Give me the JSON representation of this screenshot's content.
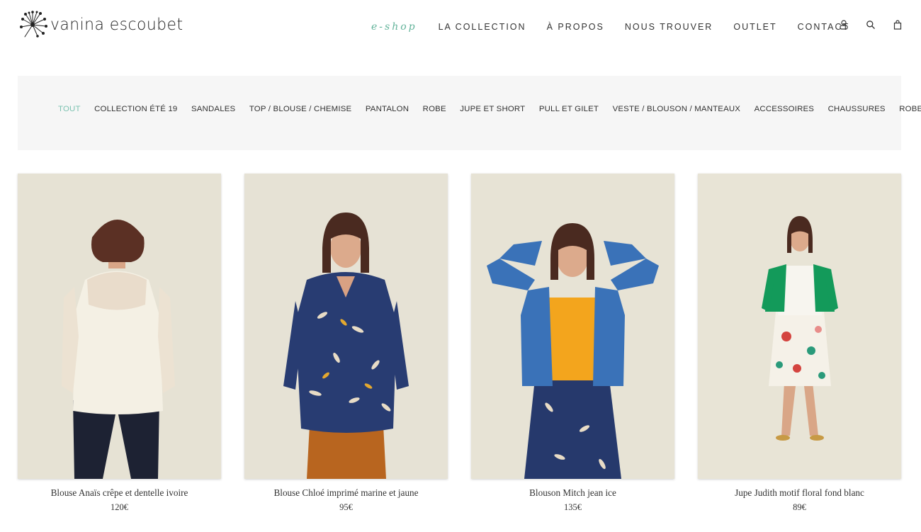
{
  "brand": {
    "name": "vanina escoubet"
  },
  "nav": {
    "items": [
      {
        "label": "e-shop"
      },
      {
        "label": "LA COLLECTION"
      },
      {
        "label": "À PROPOS"
      },
      {
        "label": "NOUS TROUVER"
      },
      {
        "label": "OUTLET"
      },
      {
        "label": "CONTACT"
      }
    ],
    "icons": [
      "user-icon",
      "search-icon",
      "shopping-bag-icon"
    ]
  },
  "filters": [
    {
      "label": "TOUT",
      "active": true
    },
    {
      "label": "COLLECTION ÉTÉ 19"
    },
    {
      "label": "SANDALES"
    },
    {
      "label": "TOP / BLOUSE / CHEMISE"
    },
    {
      "label": "PANTALON"
    },
    {
      "label": "ROBE"
    },
    {
      "label": "JUPE ET SHORT"
    },
    {
      "label": "PULL ET GILET"
    },
    {
      "label": "VESTE / BLOUSON / MANTEAUX"
    },
    {
      "label": "ACCESSOIRES"
    },
    {
      "label": "CHAUSSURES"
    },
    {
      "label": "ROBES"
    }
  ],
  "products": [
    {
      "name": "Blouse Anaïs crêpe et dentelle ivoire",
      "price": "120€"
    },
    {
      "name": "Blouse Chloé imprimé marine et jaune",
      "price": "95€"
    },
    {
      "name": "Blouson Mitch jean ice",
      "price": "135€"
    },
    {
      "name": "Jupe Judith motif floral fond blanc",
      "price": "89€"
    }
  ],
  "colors": {
    "accent": "#62b39a",
    "filter_active": "#7bc2b0",
    "filter_bg": "#f6f6f6",
    "photo_bg": "#e7e3d6"
  }
}
